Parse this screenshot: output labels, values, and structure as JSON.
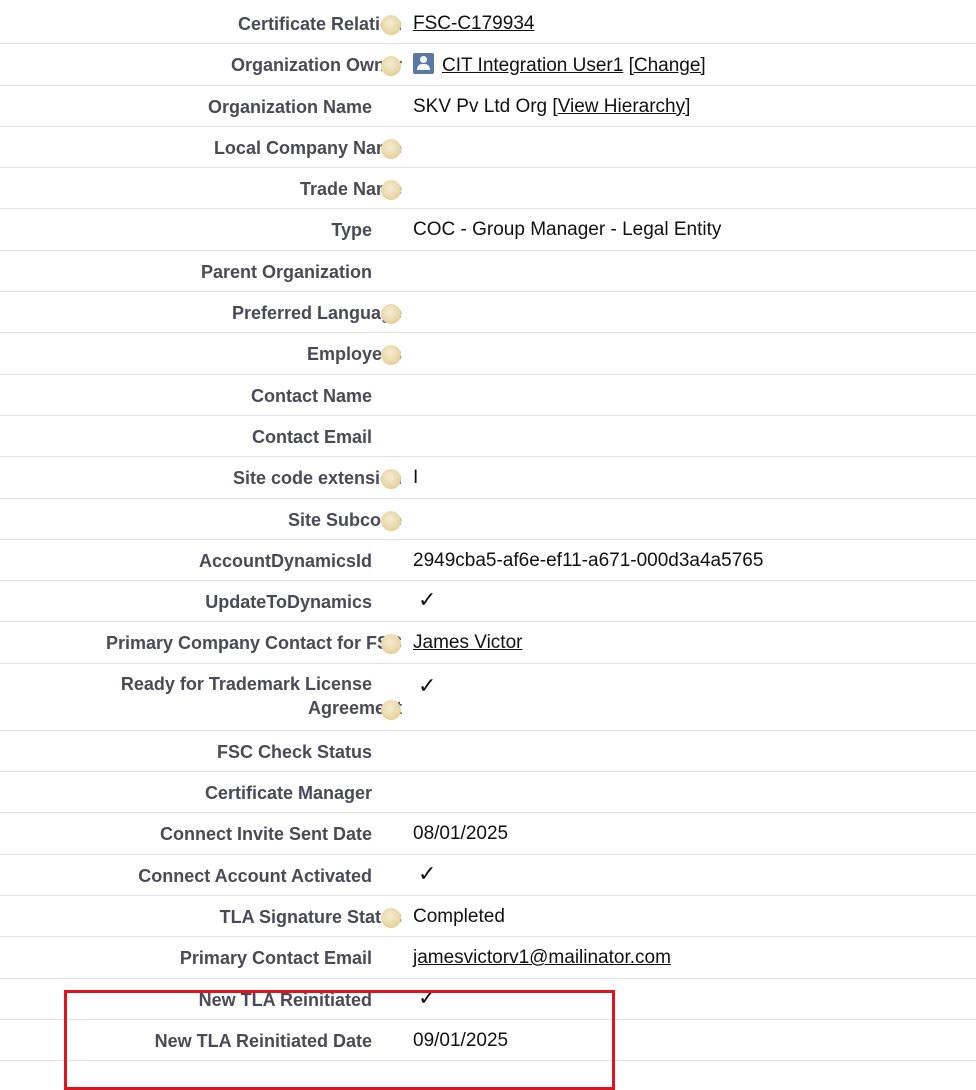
{
  "fields": {
    "certificate_relation": {
      "label": "Certificate Relation",
      "value": "FSC-C179934"
    },
    "organization_owner": {
      "label": "Organization Owner",
      "value": "CIT Integration User1",
      "change_link": "[Change]"
    },
    "organization_name": {
      "label": "Organization Name",
      "value": "SKV Pv Ltd Org",
      "hierarchy_prefix": "[",
      "hierarchy_link": "View Hierarchy",
      "hierarchy_suffix": "]"
    },
    "local_company_name": {
      "label": "Local Company Name",
      "value": ""
    },
    "trade_name": {
      "label": "Trade Name",
      "value": ""
    },
    "type": {
      "label": "Type",
      "value": "COC - Group Manager - Legal Entity"
    },
    "parent_organization": {
      "label": "Parent Organization",
      "value": ""
    },
    "preferred_language": {
      "label": "Preferred Language",
      "value": ""
    },
    "employees": {
      "label": "Employees",
      "value": ""
    },
    "contact_name": {
      "label": "Contact Name",
      "value": ""
    },
    "contact_email": {
      "label": "Contact Email",
      "value": ""
    },
    "site_code_extension": {
      "label": "Site code extension",
      "value": "I"
    },
    "site_subcode": {
      "label": "Site Subcode",
      "value": ""
    },
    "account_dynamics_id": {
      "label": "AccountDynamicsId",
      "value": "2949cba5-af6e-ef11-a671-000d3a4a5765"
    },
    "update_to_dynamics": {
      "label": "UpdateToDynamics",
      "checked": true
    },
    "primary_company_contact": {
      "label": "Primary Company Contact for FSC",
      "value": "James Victor"
    },
    "ready_for_tla": {
      "label_line1": "Ready for Trademark License",
      "label_line2": "Agreement",
      "checked": true
    },
    "fsc_check_status": {
      "label": "FSC Check Status",
      "value": ""
    },
    "certificate_manager": {
      "label": "Certificate Manager",
      "value": ""
    },
    "connect_invite_sent_date": {
      "label": "Connect Invite Sent Date",
      "value": "08/01/2025"
    },
    "connect_account_activated": {
      "label": "Connect Account Activated",
      "checked": true
    },
    "tla_signature_status": {
      "label": "TLA Signature Status",
      "value": "Completed"
    },
    "primary_contact_email": {
      "label": "Primary Contact Email",
      "value": "jamesvictorv1@mailinator.com"
    },
    "new_tla_reinitiated": {
      "label": "New TLA Reinitiated",
      "checked": true
    },
    "new_tla_reinitiated_date": {
      "label": "New TLA Reinitiated Date",
      "value": "09/01/2025"
    }
  },
  "checkmark_glyph": "✓",
  "colors": {
    "label": "#4a4a56",
    "value": "#111111",
    "highlight_border": "#e0141e",
    "help_icon": "#e9d8aa",
    "user_icon": "#5b7aa3"
  },
  "icons": {
    "help": "help-icon",
    "user": "user-icon",
    "check": "checkmark-icon"
  }
}
